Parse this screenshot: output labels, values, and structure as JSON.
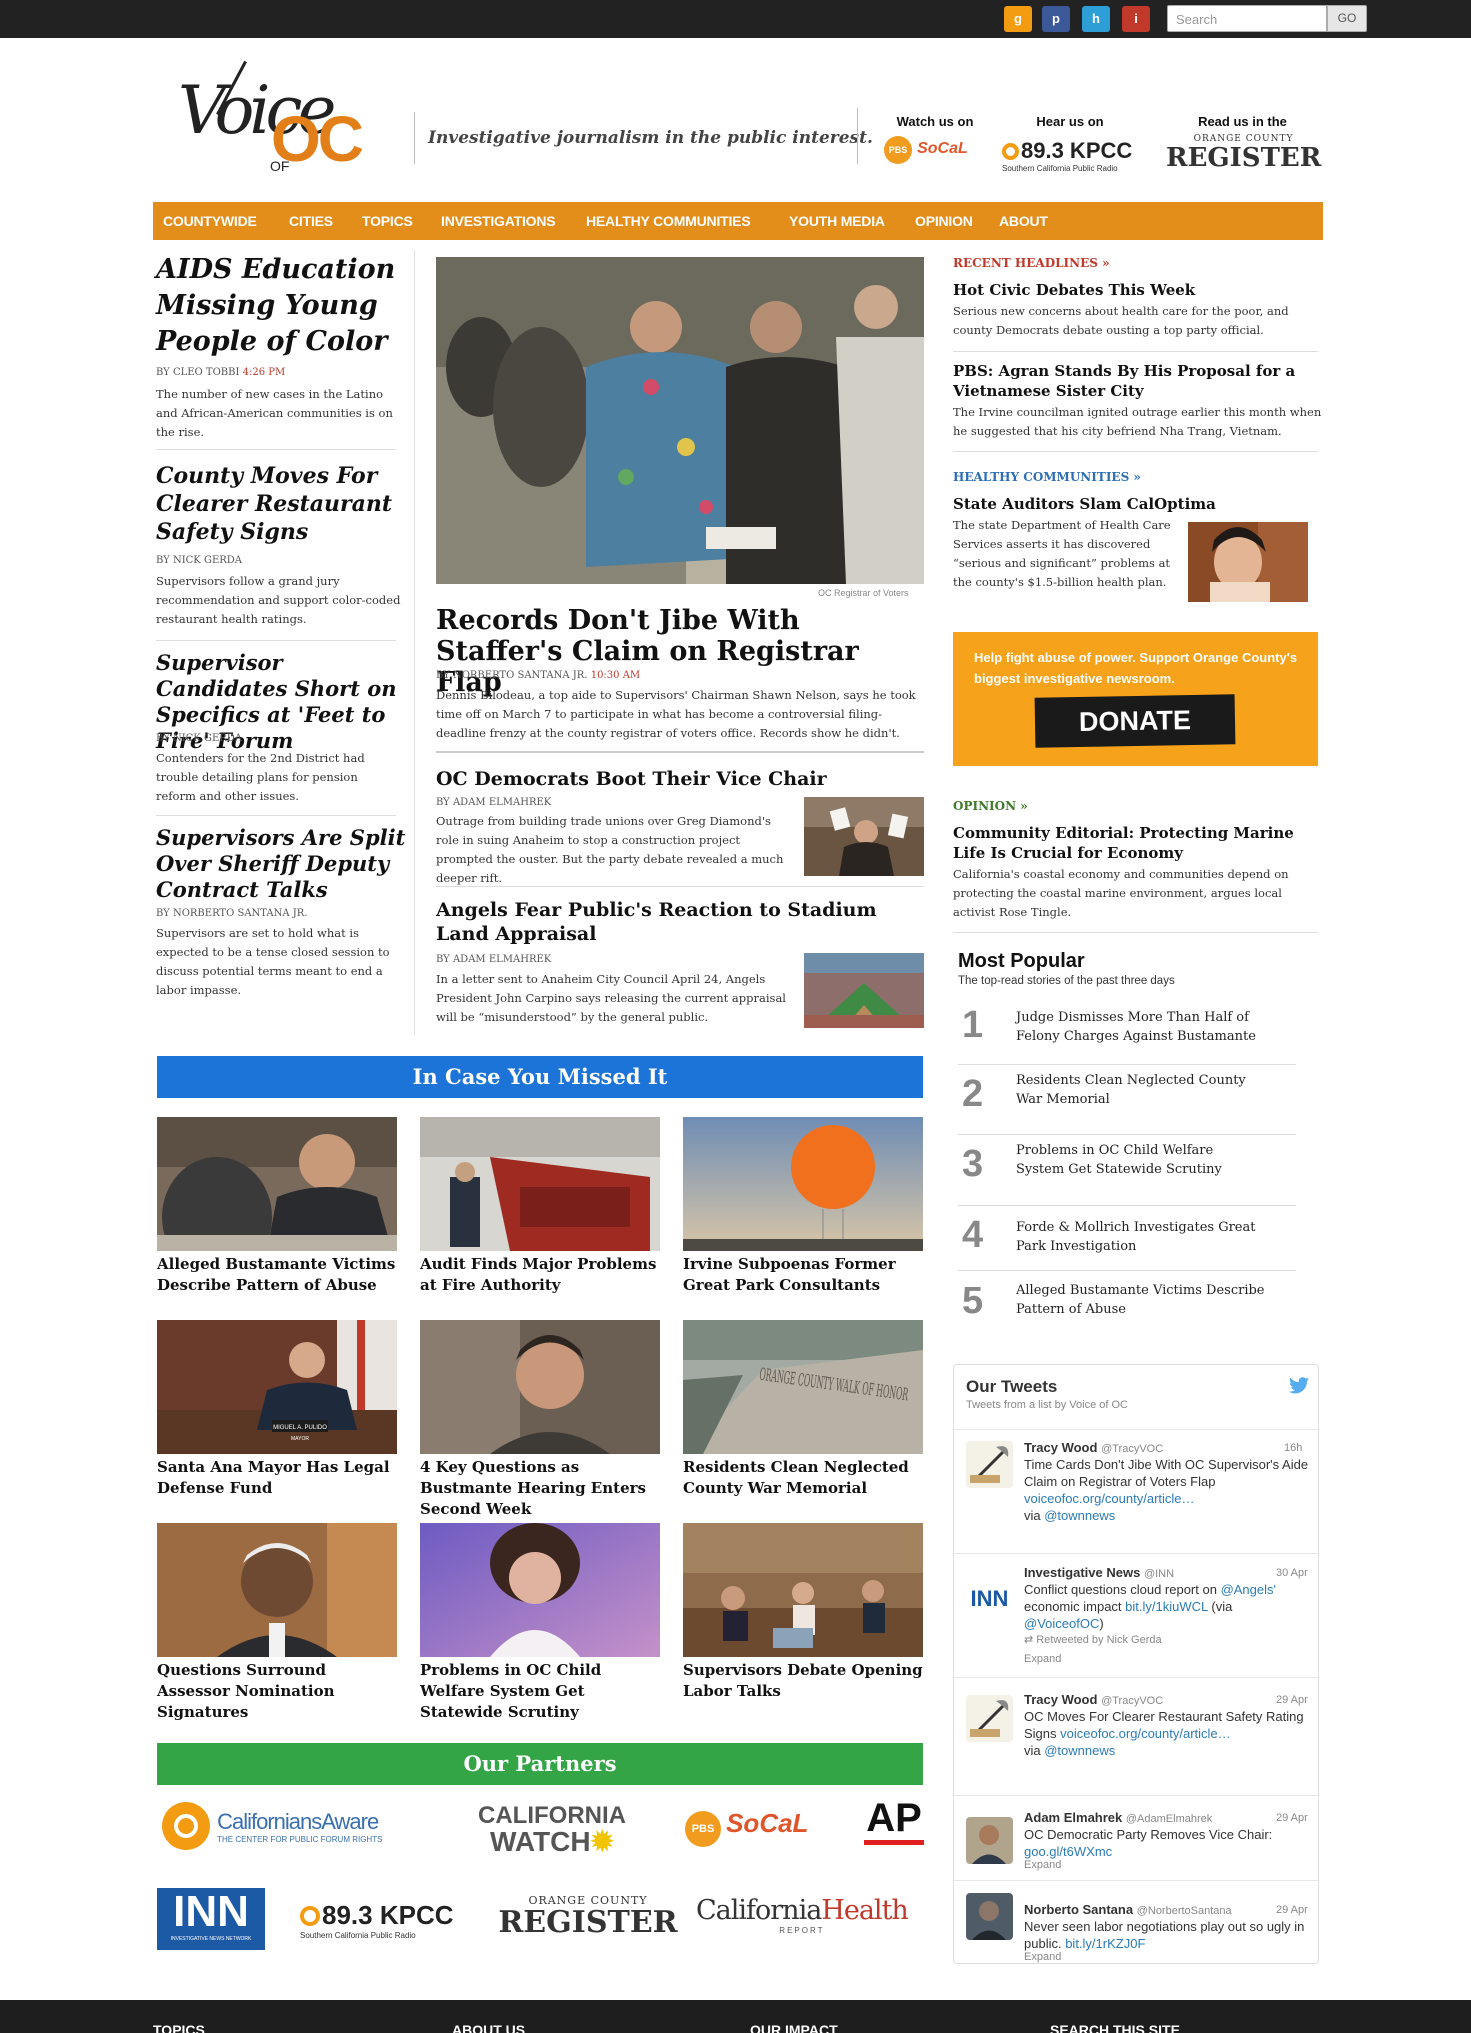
{
  "top_bar": {
    "social_icons": [
      {
        "name": "google-plus-icon",
        "glyph": "g",
        "color": "#f39c12"
      },
      {
        "name": "pinterest-icon",
        "glyph": "p",
        "color": "#3b5998"
      },
      {
        "name": "h-icon",
        "glyph": "h",
        "color": "#2e9fd6"
      },
      {
        "name": "i-icon",
        "glyph": "i",
        "color": "#c0392b"
      }
    ],
    "search_placeholder": "Search",
    "search_button": "GO"
  },
  "header": {
    "logo_voice": "Voice",
    "logo_of": "OF",
    "logo_oc": "OC",
    "tagline": "Investigative journalism in the public interest.",
    "watch_label": "Watch us on",
    "watch_pbs": "PBS",
    "watch_socal": "SoCaL",
    "hear_label": "Hear us on",
    "hear_station": "89.3 KPCC",
    "hear_sub": "Southern California Public Radio",
    "read_label": "Read us in the",
    "read_sub": "ORANGE COUNTY",
    "read_paper": "REGISTER"
  },
  "nav": [
    "COUNTYWIDE",
    "CITIES",
    "TOPICS",
    "INVESTIGATIONS",
    "HEALTHY COMMUNITIES",
    "YOUTH MEDIA",
    "OPINION",
    "ABOUT"
  ],
  "left_stories": [
    {
      "title": "AIDS Education Missing Young People of Color",
      "by": "By CLEO TOBBI",
      "time": "4:26 PM",
      "summary": "The number of new cases in the Latino and African-American communities is on the rise."
    },
    {
      "title": "County Moves For Clearer Restaurant Safety Signs",
      "by": "By NICK GERDA",
      "summary": "Supervisors follow a grand jury recommendation and support color-coded restaurant health ratings."
    },
    {
      "title": "Supervisor Candidates Short on Specifics at 'Feet to Fire' Forum",
      "by": "By NICK GERDA",
      "summary": "Contenders for the 2nd District had trouble detailing plans for pension reform and other issues."
    },
    {
      "title": "Supervisors Are Split Over Sheriff Deputy Contract Talks",
      "by": "By NORBERTO SANTANA JR.",
      "summary": "Supervisors are set to hold what is expected to be a tense closed session to discuss potential terms meant to end a labor impasse."
    }
  ],
  "lead": {
    "photo_credit": "OC Registrar of Voters",
    "title": "Records Don't Jibe With Staffer's Claim on Registrar Flap",
    "by": "By NORBERTO SANTANA JR.",
    "time": "10:30 AM",
    "summary": "Dennis Bilodeau, a top aide to Supervisors' Chairman Shawn Nelson, says he took time off on March 7 to participate in what has become a controversial filing-deadline frenzy at the county registrar of voters office. Records show he didn't."
  },
  "center_stories": [
    {
      "title": "OC Democrats Boot Their Vice Chair",
      "by": "By ADAM ELMAHREK",
      "summary": "Outrage from building trade unions over Greg Diamond's role in suing Anaheim to stop a construction project prompted the ouster. But the party debate revealed a much deeper rift."
    },
    {
      "title": "Angels Fear Public's Reaction to Stadium Land Appraisal",
      "by": "By ADAM ELMAHREK",
      "summary": "In a letter sent to Anaheim City Council April 24, Angels President John Carpino says releasing the current appraisal will be “misunderstood” by the general public."
    }
  ],
  "right": {
    "recent_label": "RECENT HEADLINES »",
    "recent": [
      {
        "title": "Hot Civic Debates This Week",
        "summary": "Serious new concerns about health care for the poor, and county Democrats debate ousting a top party official."
      },
      {
        "title": "PBS: Agran Stands By His Proposal for a Vietnamese Sister City",
        "summary": "The Irvine councilman ignited outrage earlier this month when he suggested that his city befriend Nha Trang, Vietnam."
      }
    ],
    "healthy_label": "HEALTHY COMMUNITIES »",
    "healthy": {
      "title": "State Auditors Slam CalOptima",
      "summary": "The state Department of Health Care Services asserts it has discovered “serious and significant” problems at the county's $1.5-billion health plan."
    },
    "donate_text": "Help fight abuse of power. Support Orange County's biggest investigative newsroom.",
    "donate_button": "DONATE",
    "opinion_label": "OPINION »",
    "opinion": {
      "title": "Community Editorial: Protecting Marine Life Is Crucial for Economy",
      "summary": "California's coastal economy and communities depend on protecting the coastal marine environment, argues local activist Rose Tingle."
    },
    "most_popular_title": "Most Popular",
    "most_popular_sub": "The top-read stories of the past three days",
    "most_popular": [
      {
        "num": "1",
        "title": "Judge Dismisses More Than Half of Felony Charges Against Bustamante"
      },
      {
        "num": "2",
        "title": "Residents Clean Neglected County War Memorial"
      },
      {
        "num": "3",
        "title": "Problems in OC Child Welfare System Get Statewide Scrutiny"
      },
      {
        "num": "4",
        "title": "Forde & Mollrich Investigates Great Park Investigation"
      },
      {
        "num": "5",
        "title": "Alleged Bustamante Victims Describe Pattern of Abuse"
      }
    ]
  },
  "missed": {
    "title": "In Case You Missed It",
    "items": [
      "Alleged Bustamante Victims Describe Pattern of Abuse",
      "Audit Finds Major Problems at Fire Authority",
      "Irvine Subpoenas Former Great Park Consultants",
      "Santa Ana Mayor Has Legal Defense Fund",
      "4 Key Questions as Bustmante Hearing Enters Second Week",
      "Residents Clean Neglected County War Memorial",
      "Questions Surround Assessor Nomination Signatures",
      "Problems in OC Child Welfare System Get Statewide Scrutiny",
      "Supervisors Debate Opening Labor Talks"
    ],
    "photo_text": {
      "memorial": "ORANGE COUNTY WALK OF HONOR",
      "placard": "MIGUEL A. PULIDO",
      "placard_sub": "MAYOR"
    }
  },
  "tweets": {
    "title": "Our Tweets",
    "subtitle": "Tweets from a list by Voice of OC",
    "items": [
      {
        "name": "Tracy Wood",
        "handle": "@TracyVOC",
        "time": "16h",
        "text": "Time Cards Don't Jibe With OC Supervisor's Aide Claim on Registrar of Voters Flap ",
        "link": "voiceofoc.org/county/article…",
        "via": "via ",
        "via_handle": "@townnews"
      },
      {
        "name": "Investigative News",
        "handle": "@INN",
        "time": "30 Apr",
        "text": "Conflict questions cloud report on ",
        "mention": "@Angels'",
        "text2": " economic impact ",
        "link": "bit.ly/1kiuWCL",
        "text3": " (via ",
        "mention2": "@VoiceofOC",
        "text4": ")",
        "retweet": "Retweeted by Nick Gerda",
        "expand": "Expand",
        "avatar_text": "INN"
      },
      {
        "name": "Tracy Wood",
        "handle": "@TracyVOC",
        "time": "29 Apr",
        "text": "OC Moves For Clearer Restaurant Safety Rating Signs ",
        "link": "voiceofoc.org/county/article…",
        "via": "via ",
        "via_handle": "@townnews"
      },
      {
        "name": "Adam Elmahrek",
        "handle": "@AdamElmahrek",
        "time": "29 Apr",
        "text": "OC Democratic Party Removes Vice Chair: ",
        "link": "goo.gl/t6WXmc",
        "expand": "Expand"
      },
      {
        "name": "Norberto Santana",
        "handle": "@NorbertoSantana",
        "time": "29 Apr",
        "text": "Never seen labor negotiations play out so ugly in public. ",
        "link": "bit.ly/1rKZJ0F",
        "expand": "Expand"
      }
    ]
  },
  "partners": {
    "title": "Our Partners",
    "ca_aware": "CaliforniansAware",
    "ca_aware_sub": "THE CENTER FOR PUBLIC FORUM RIGHTS",
    "ca_watch_1": "CALIFORNIA",
    "ca_watch_2": "WATCH",
    "pbs": "PBS",
    "socal": "SoCaL",
    "ap": "AP",
    "inn": "INN",
    "inn_sub": "INVESTIGATIVE NEWS NETWORK",
    "kpcc": "89.3 KPCC",
    "kpcc_sub": "Southern California Public Radio",
    "register_sub": "ORANGE COUNTY",
    "register": "REGISTER",
    "health_1": "California",
    "health_2": "Health",
    "health_sub": "REPORT"
  },
  "footer": [
    "TOPICS",
    "ABOUT US",
    "OUR IMPACT",
    "SEARCH THIS SITE"
  ]
}
